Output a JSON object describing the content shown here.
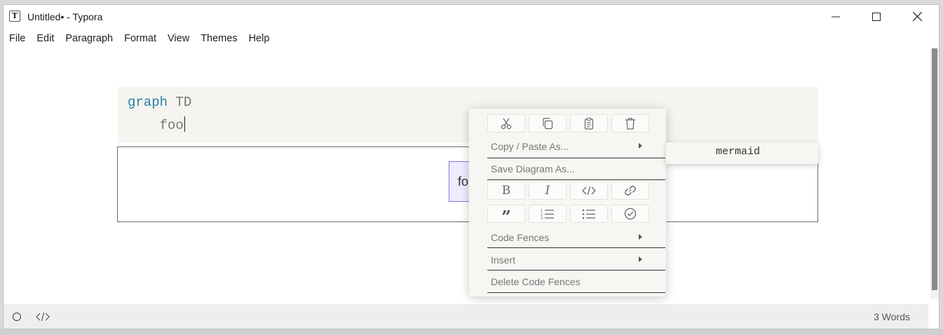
{
  "window": {
    "title": "Untitled• - Typora",
    "app_icon_letter": "T"
  },
  "menubar": {
    "items": [
      "File",
      "Edit",
      "Paragraph",
      "Format",
      "View",
      "Themes",
      "Help"
    ]
  },
  "editor": {
    "code_keyword": "graph",
    "code_direction": "TD",
    "code_line2": "    foo",
    "diagram_node_text": "fo"
  },
  "context_menu": {
    "icon_row_1": [
      "cut-icon",
      "copy-icon",
      "paste-icon",
      "delete-icon"
    ],
    "copy_paste_as": "Copy / Paste As...",
    "save_diagram_as": "Save Diagram As...",
    "icon_row_2": [
      "bold-icon",
      "italic-icon",
      "code-icon",
      "link-icon"
    ],
    "icon_row_3": [
      "quote-icon",
      "ordered-list-icon",
      "bullet-list-icon",
      "task-list-icon"
    ],
    "code_fences": "Code Fences",
    "insert": "Insert",
    "delete_code_fences": "Delete Code Fences"
  },
  "submenu": {
    "item": "mermaid"
  },
  "statusbar": {
    "word_count": "3 Words"
  }
}
